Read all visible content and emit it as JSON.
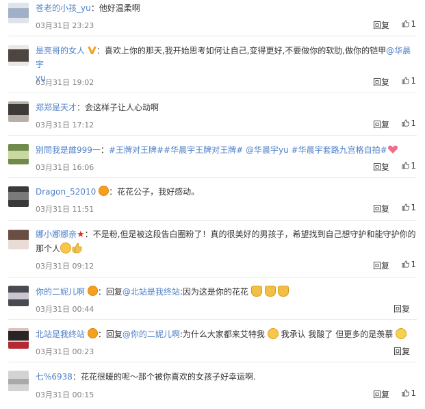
{
  "ui": {
    "reply_label": "回复",
    "like_count": "1",
    "colon": "："
  },
  "comments": [
    {
      "user": "苍老的小孩_yu",
      "parts": [
        "他好温柔啊"
      ],
      "time": "03月31日 23:23"
    },
    {
      "user": "是亮哥的女人",
      "line1": "喜欢上你的那天,我开始思考如何让自己,变得更好,不要做你的软肋,做你的铠甲",
      "mention": "@华晨宇",
      "mention_cont": "yu",
      "time": "03月31日 19:02"
    },
    {
      "user": "郑郑是天才",
      "parts": [
        "会这样子让人心动啊"
      ],
      "time": "03月31日 17:12"
    },
    {
      "user": "别問我是誰999一",
      "topic1": "#王牌对王牌#",
      "topic2": "#华晨宇王牌对王牌#",
      "mention": "@华晨宇yu",
      "topic3": "#华晨宇套路九宫格自拍#",
      "time": "03月31日 16:06"
    },
    {
      "user": "Dragon_52010",
      "parts": [
        "花花公子，我好感动。"
      ],
      "time": "03月31日 11:51"
    },
    {
      "user": "娜小娜娜亲",
      "line1": "不是粉,但是被这段告白圈粉了！真的很美好的男孩子，希望找到自己想守护和能守护你的",
      "line2": "那个人",
      "time": "03月31日 09:12"
    },
    {
      "user": "你的二妮儿啊",
      "reply_prefix": "回复",
      "mention": "@北站是我终站",
      "body": ":因为这是你的花花",
      "time": "03月31日 00:44"
    },
    {
      "user": "北站是我终站",
      "reply_prefix": "回复",
      "mention": "@你的二妮儿啊",
      "body": ":为什么大家都来艾特我",
      "body2": "我承认 我酸了 但更多的是羡慕",
      "time": "03月31日 00:23"
    },
    {
      "user": "七%6938",
      "parts": [
        "花花很暖的呢～那个被你喜欢的女孩子好幸运啊."
      ],
      "time": "03月31日 00:15"
    }
  ]
}
